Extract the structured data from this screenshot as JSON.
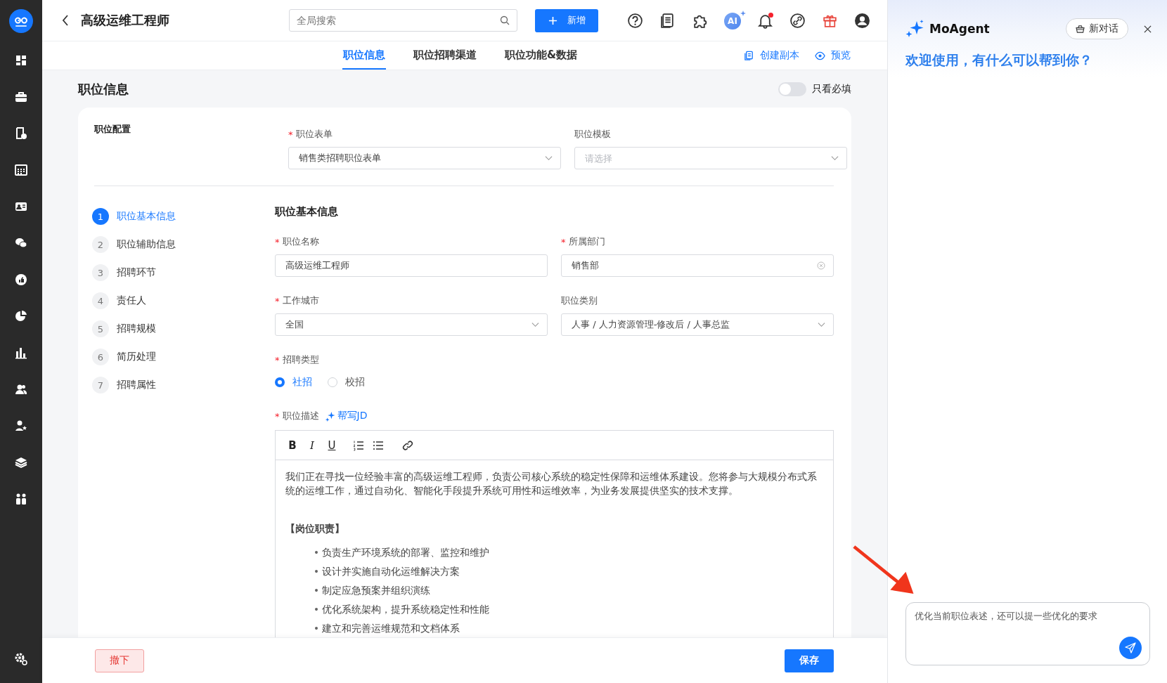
{
  "header": {
    "title": "高级运维工程师",
    "search": {
      "placeholder": "全局搜索"
    },
    "new_button": "新增",
    "ai_label": "AI",
    "notification_unread": true
  },
  "tabs": [
    {
      "label": "职位信息",
      "selected": true
    },
    {
      "label": "职位招聘渠道",
      "selected": false
    },
    {
      "label": "职位功能&数据",
      "selected": false
    }
  ],
  "tab_actions": [
    {
      "kind": "copy",
      "label": "创建副本"
    },
    {
      "kind": "preview",
      "label": "预览"
    }
  ],
  "section_title": "职位信息",
  "required_only": {
    "label": "只看必填",
    "on": false
  },
  "required_mark": "*",
  "config": {
    "title": "职位配置",
    "fields": [
      {
        "label": "职位表单",
        "required": true,
        "kind": "select",
        "value": "销售类招聘职位表单"
      },
      {
        "label": "职位模板",
        "required": false,
        "kind": "select",
        "placeholder": "请选择"
      }
    ]
  },
  "steps": [
    {
      "number": "1",
      "label": "职位基本信息",
      "selected": true
    },
    {
      "number": "2",
      "label": "职位辅助信息",
      "selected": false
    },
    {
      "number": "3",
      "label": "招聘环节",
      "selected": false
    },
    {
      "number": "4",
      "label": "责任人",
      "selected": false
    },
    {
      "number": "5",
      "label": "招聘规模",
      "selected": false
    },
    {
      "number": "6",
      "label": "简历处理",
      "selected": false
    },
    {
      "number": "7",
      "label": "招聘属性",
      "selected": false
    }
  ],
  "basic_info": {
    "title": "职位基本信息",
    "fields": [
      {
        "label": "职位名称",
        "required": true,
        "kind": "text",
        "value": "高级运维工程师"
      },
      {
        "label": "所属部门",
        "required": true,
        "kind": "clearable",
        "value": "销售部"
      },
      {
        "label": "工作城市",
        "required": true,
        "kind": "select",
        "value": "全国"
      },
      {
        "label": "职位类别",
        "required": false,
        "kind": "select",
        "value": "人事 / 人力资源管理-修改后 / 人事总监"
      }
    ],
    "recruit_type": {
      "label": "招聘类型",
      "required": true,
      "options": [
        {
          "label": "社招",
          "selected": true
        },
        {
          "label": "校招",
          "selected": false
        }
      ]
    },
    "description": {
      "label": "职位描述",
      "required": true,
      "ai_link": "帮写JD",
      "toolbar": [
        {
          "kind": "bold",
          "glyph": "B"
        },
        {
          "kind": "italic",
          "glyph": "I"
        },
        {
          "kind": "underline",
          "glyph": "U"
        },
        {
          "kind": "ordered-list"
        },
        {
          "kind": "bullet-list"
        },
        {
          "kind": "link"
        }
      ],
      "intro": "我们正在寻找一位经验丰富的高级运维工程师，负责公司核心系统的稳定性保障和运维体系建设。您将参与大规模分布式系统的运维工作，通过自动化、智能化手段提升系统可用性和运维效率，为业务发展提供坚实的技术支撑。",
      "heading": "【岗位职责】",
      "bullet_mark": "•",
      "bullets": [
        "负责生产环境系统的部署、监控和维护",
        "设计并实施自动化运维解决方案",
        "制定应急预案并组织演练",
        "优化系统架构，提升系统稳定性和性能",
        "建立和完善运维规范和文档体系"
      ]
    }
  },
  "footer": {
    "withdraw": "撤下",
    "save": "保存"
  },
  "assistant": {
    "name": "MoAgent",
    "new_chat": "新对话",
    "welcome": "欢迎使用，有什么可以帮到你？",
    "input": {
      "value": "优化当前职位表述，还可以提一些优化的要求"
    }
  }
}
